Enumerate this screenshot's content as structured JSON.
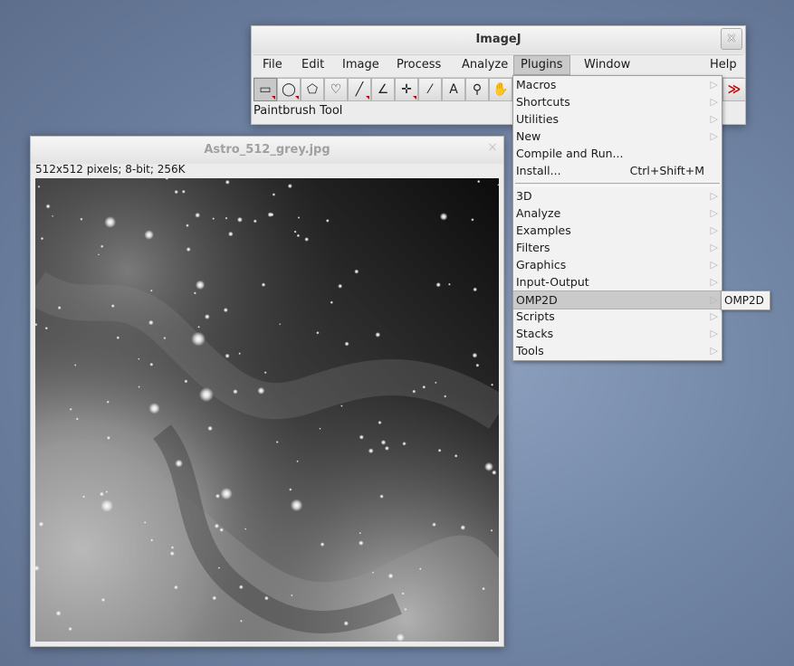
{
  "imagej": {
    "title": "ImageJ",
    "close_glyph": "×",
    "menus": [
      {
        "label": "File"
      },
      {
        "label": "Edit"
      },
      {
        "label": "Image"
      },
      {
        "label": "Process"
      },
      {
        "label": "Analyze"
      },
      {
        "label": "Plugins",
        "active": true
      },
      {
        "label": "Window"
      },
      {
        "label": "Help"
      }
    ],
    "tools": [
      {
        "icon": "rectangle-select-icon",
        "glyph": "▭",
        "selected": true
      },
      {
        "icon": "oval-select-icon",
        "glyph": "◯"
      },
      {
        "icon": "polygon-select-icon",
        "glyph": "⬠"
      },
      {
        "icon": "freehand-select-icon",
        "glyph": "♡"
      },
      {
        "icon": "line-tool-icon",
        "glyph": "╱"
      },
      {
        "icon": "angle-tool-icon",
        "glyph": "∠"
      },
      {
        "icon": "point-tool-icon",
        "glyph": "✛"
      },
      {
        "icon": "wand-tool-icon",
        "glyph": "⁄"
      },
      {
        "icon": "text-tool-icon",
        "glyph": "A"
      },
      {
        "icon": "magnifier-icon",
        "glyph": "⚲"
      },
      {
        "icon": "hand-tool-icon",
        "glyph": "✋"
      }
    ],
    "more_tools_glyph": "≫",
    "status": "Paintbrush Tool"
  },
  "image_window": {
    "title": "Astro_512_grey.jpg",
    "close_glyph": "×",
    "info": "512x512 pixels; 8-bit; 256K"
  },
  "plugins_menu": {
    "items_top": [
      {
        "label": "Macros",
        "submenu": true
      },
      {
        "label": "Shortcuts",
        "submenu": true
      },
      {
        "label": "Utilities",
        "submenu": true
      },
      {
        "label": "New",
        "submenu": true
      },
      {
        "label": "Compile and Run...",
        "submenu": false
      },
      {
        "label": "Install...",
        "shortcut": "Ctrl+Shift+M",
        "submenu": false
      }
    ],
    "items_bottom": [
      {
        "label": "3D",
        "submenu": true
      },
      {
        "label": "Analyze",
        "submenu": true
      },
      {
        "label": "Examples",
        "submenu": true
      },
      {
        "label": "Filters",
        "submenu": true
      },
      {
        "label": "Graphics",
        "submenu": true
      },
      {
        "label": "Input-Output",
        "submenu": true
      },
      {
        "label": "OMP2D",
        "submenu": true,
        "highlighted": true
      },
      {
        "label": "Scripts",
        "submenu": true
      },
      {
        "label": "Stacks",
        "submenu": true
      },
      {
        "label": "Tools",
        "submenu": true
      }
    ],
    "arrow_glyph": "▷"
  },
  "submenu": {
    "items": [
      {
        "label": "OMP2D"
      }
    ]
  }
}
